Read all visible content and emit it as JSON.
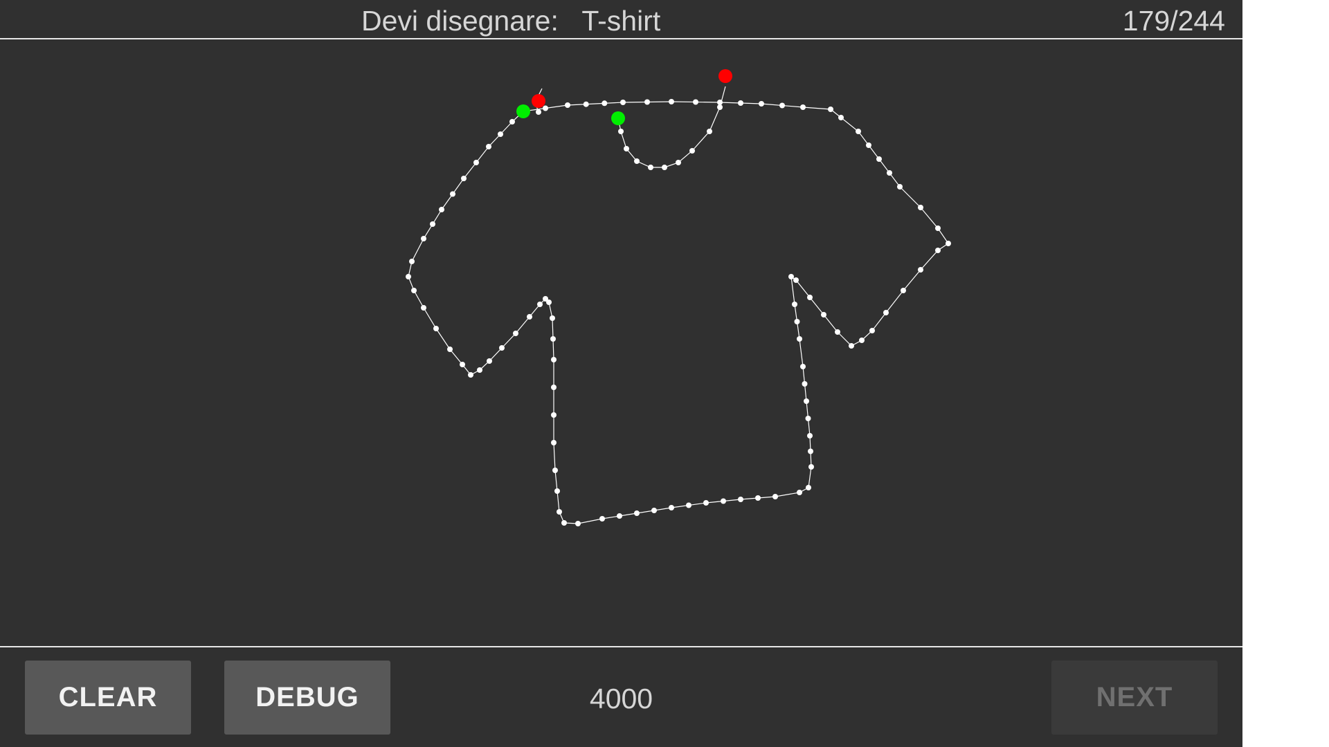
{
  "header": {
    "prompt_label": "Devi disegnare:",
    "prompt_word": "T-shirt",
    "progress": "179/244"
  },
  "toolbar": {
    "clear_label": "CLEAR",
    "debug_label": "DEBUG",
    "value": "4000",
    "next_label": "NEXT"
  },
  "drawing": {
    "stroke_color": "#ffffff",
    "stroke_start_color": "#00ee00",
    "stroke_end_color": "#ff0000",
    "background": "#303030"
  }
}
